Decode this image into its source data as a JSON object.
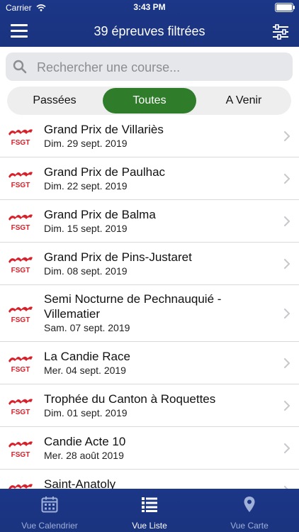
{
  "status_bar": {
    "carrier": "Carrier",
    "time": "3:43 PM"
  },
  "header": {
    "title": "39 épreuves filtrées"
  },
  "search": {
    "placeholder": "Rechercher une course..."
  },
  "segments": [
    {
      "label": "Passées",
      "active": false
    },
    {
      "label": "Toutes",
      "active": true
    },
    {
      "label": "A Venir",
      "active": false
    }
  ],
  "logo_text": "FSGT",
  "races": [
    {
      "name": "Grand Prix de Villariès",
      "date": "Dim. 29 sept. 2019"
    },
    {
      "name": "Grand Prix de Paulhac",
      "date": "Dim. 22 sept. 2019"
    },
    {
      "name": "Grand Prix de Balma",
      "date": "Dim. 15 sept. 2019"
    },
    {
      "name": "Grand Prix de Pins-Justaret",
      "date": "Dim. 08 sept. 2019"
    },
    {
      "name": "Semi Nocturne de Pechnauquié - Villematier",
      "date": "Sam. 07 sept. 2019"
    },
    {
      "name": "La Candie Race",
      "date": "Mer. 04 sept. 2019"
    },
    {
      "name": "Trophée du Canton à Roquettes",
      "date": "Dim. 01 sept. 2019"
    },
    {
      "name": "Candie Acte 10",
      "date": "Mer. 28 août 2019"
    },
    {
      "name": "Saint-Anatoly",
      "date": ""
    }
  ],
  "tabs": [
    {
      "label": "Vue Calendrier",
      "icon": "calendar-icon",
      "active": false
    },
    {
      "label": "Vue Liste",
      "icon": "list-icon",
      "active": true
    },
    {
      "label": "Vue Carte",
      "icon": "map-pin-icon",
      "active": false
    }
  ],
  "colors": {
    "brand_blue": "#1c3688",
    "accent_green": "#2f7d2b",
    "logo_red": "#d8202a"
  }
}
